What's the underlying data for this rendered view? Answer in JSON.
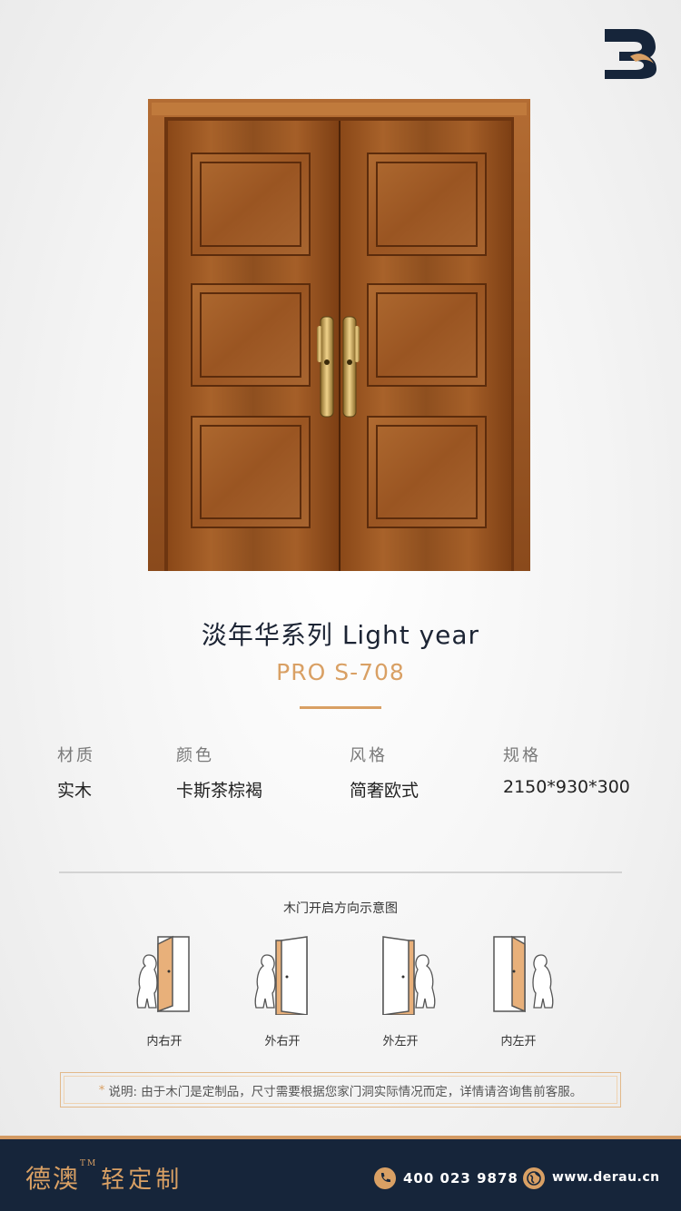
{
  "brand": {
    "logo_icon": "derau-logo-icon"
  },
  "product": {
    "series": "淡年华系列  Light year",
    "model": "PRO S-708",
    "accent_color": "#d9a064"
  },
  "specs": [
    {
      "label": "材质",
      "value": "实木"
    },
    {
      "label": "颜色",
      "value": "卡斯茶棕褐"
    },
    {
      "label": "风格",
      "value": "简奢欧式"
    },
    {
      "label": "规格",
      "value": "2150*930*300"
    }
  ],
  "diagram": {
    "title": "木门开启方向示意图",
    "items": [
      {
        "label": "内右开",
        "icon": "door-open-inward-right-icon"
      },
      {
        "label": "外右开",
        "icon": "door-open-outward-right-icon"
      },
      {
        "label": "外左开",
        "icon": "door-open-outward-left-icon"
      },
      {
        "label": "内左开",
        "icon": "door-open-inward-left-icon"
      }
    ]
  },
  "note": {
    "mark": "*",
    "text": "说明: 由于木门是定制品，尺寸需要根据您家门洞实际情况而定，详情请咨询售前客服。"
  },
  "footer": {
    "brand_name": "德澳",
    "trademark": "TM",
    "brand_sub": "轻定制",
    "phone": "400 023 9878",
    "website": "www.derau.cn",
    "phone_icon": "phone-icon",
    "web_icon": "globe-icon",
    "background_color": "#16253a"
  }
}
